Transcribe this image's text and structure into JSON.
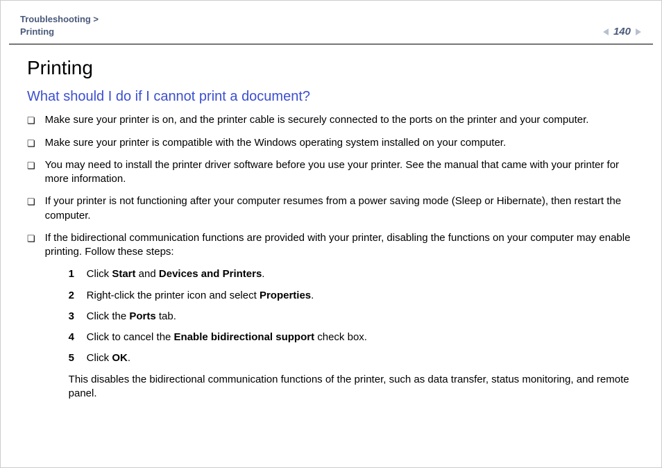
{
  "header": {
    "breadcrumb_top": "Troubleshooting >",
    "breadcrumb_bottom": "Printing",
    "page_number": "140",
    "nav_prev": "◀",
    "nav_next": "▶"
  },
  "content": {
    "title": "Printing",
    "subtitle": "What should I do if I cannot print a document?",
    "bullets": [
      "Make sure your printer is on, and the printer cable is securely connected to the ports on the printer and your computer.",
      "Make sure your printer is compatible with the Windows operating system installed on your computer.",
      "You may need to install the printer driver software before you use your printer. See the manual that came with your printer for more information.",
      "If your printer is not functioning after your computer resumes from a power saving mode (Sleep or Hibernate), then restart the computer.",
      "If the bidirectional communication functions are provided with your printer, disabling the functions on your computer may enable printing. Follow these steps:"
    ],
    "steps": [
      {
        "n": "1",
        "pre": "Click ",
        "b1": "Start",
        "mid": " and ",
        "b2": "Devices and Printers",
        "post": "."
      },
      {
        "n": "2",
        "pre": "Right-click the printer icon and select ",
        "b1": "Properties",
        "mid": "",
        "b2": "",
        "post": "."
      },
      {
        "n": "3",
        "pre": "Click the ",
        "b1": "Ports",
        "mid": "",
        "b2": "",
        "post": " tab."
      },
      {
        "n": "4",
        "pre": "Click to cancel the ",
        "b1": "Enable bidirectional support",
        "mid": "",
        "b2": "",
        "post": " check box."
      },
      {
        "n": "5",
        "pre": "Click ",
        "b1": "OK",
        "mid": "",
        "b2": "",
        "post": "."
      }
    ],
    "after_steps": "This disables the bidirectional communication functions of the printer, such as data transfer, status monitoring, and remote panel."
  }
}
